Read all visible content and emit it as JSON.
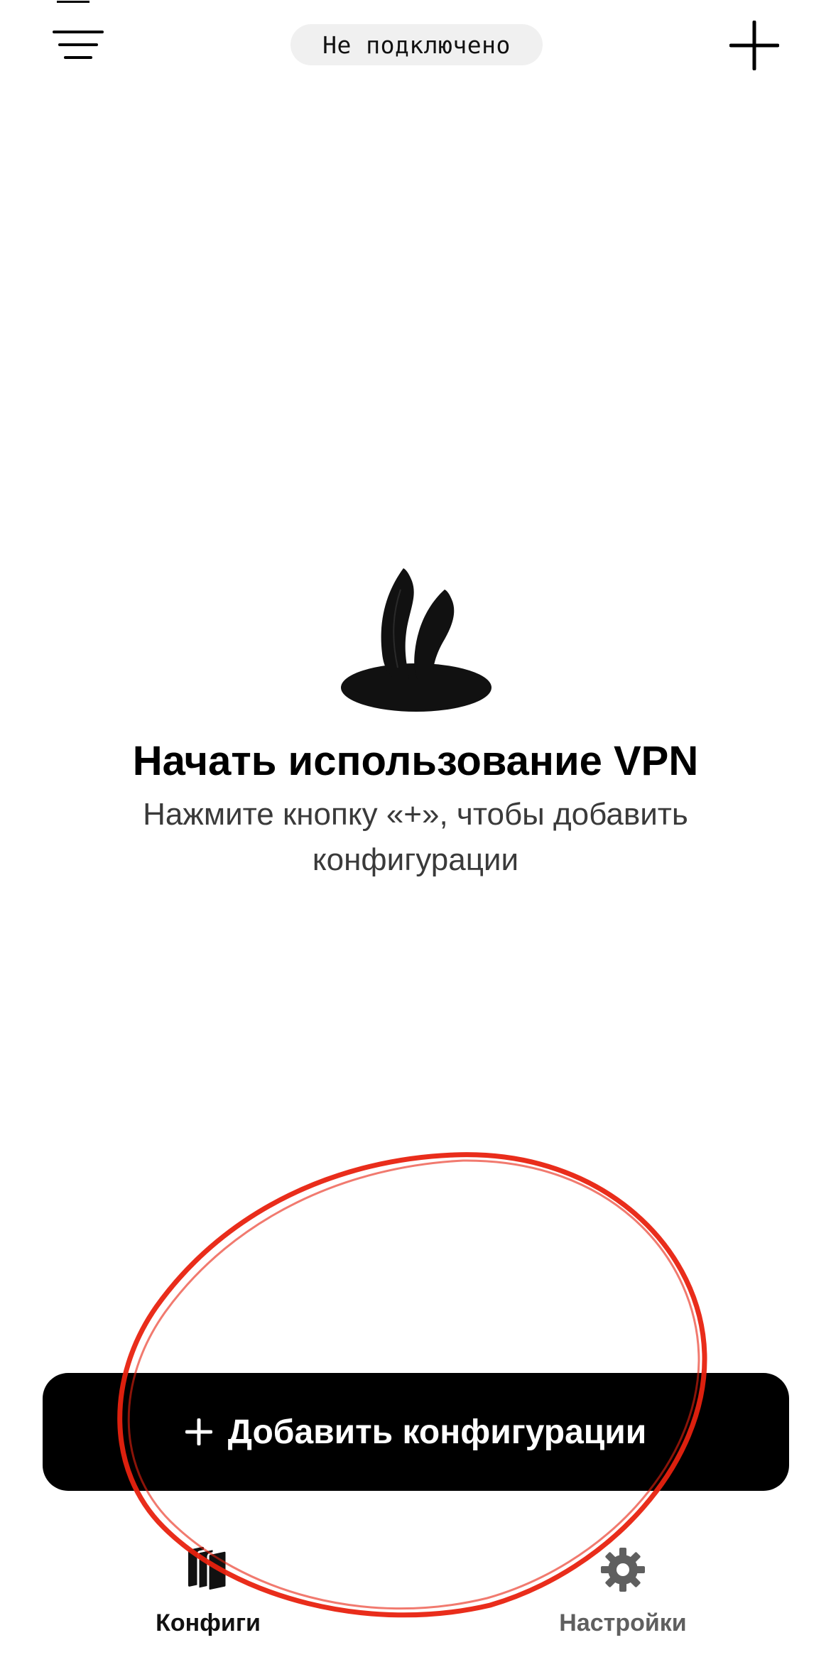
{
  "header": {
    "status": "Не подключено"
  },
  "empty_state": {
    "title": "Начать использование VPN",
    "subtitle": "Нажмите кнопку «+», чтобы добавить конфигурации"
  },
  "primary_action": {
    "label": "Добавить конфигурации"
  },
  "tab_bar": {
    "tabs": [
      {
        "label": "Конфиги",
        "icon": "configs-stack-icon",
        "active": true
      },
      {
        "label": "Настройки",
        "icon": "gear-icon",
        "active": false
      }
    ]
  },
  "colors": {
    "background": "#ffffff",
    "text": "#000000",
    "pill": "#f0f0f0",
    "button": "#000000",
    "tab_inactive": "#5f5f5f",
    "annotation": "#e8220f"
  }
}
